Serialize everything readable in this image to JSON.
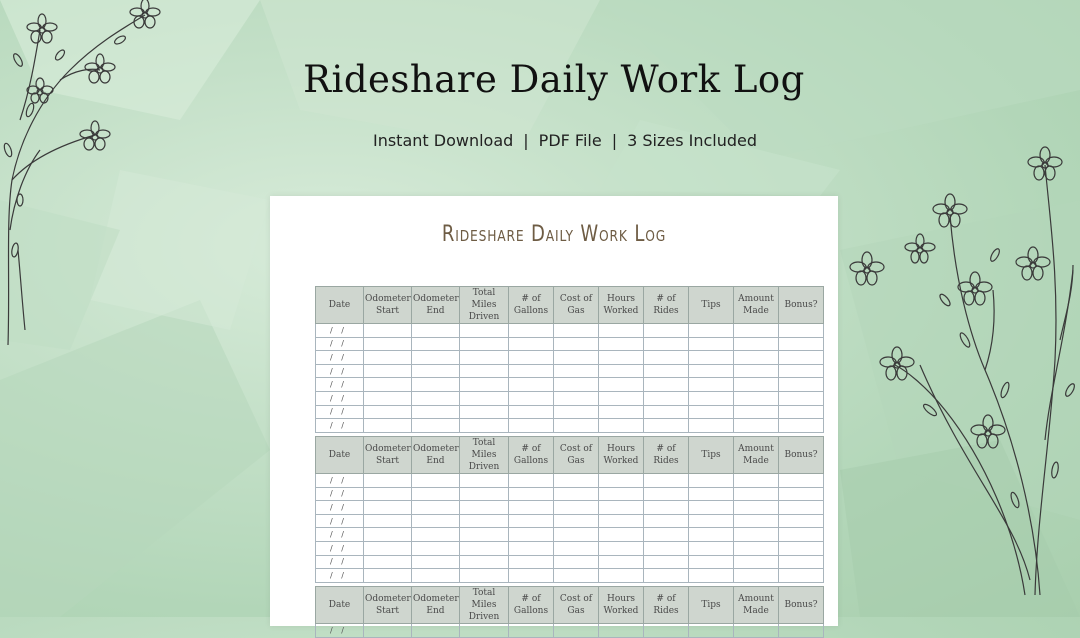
{
  "hero": {
    "title": "Rideshare Daily Work Log",
    "subtitle_parts": [
      "Instant Download",
      "PDF File",
      "3 Sizes Included"
    ],
    "separator": "|"
  },
  "sheet": {
    "title": "Rideshare Daily Work Log",
    "columns": [
      "Date",
      "Odometer Start",
      "Odometer End",
      "Total Miles Driven",
      "# of Gallons",
      "Cost of Gas",
      "Hours Worked",
      "# of Rides",
      "Tips",
      "Amount Made",
      "Bonus?"
    ],
    "date_placeholder": "/ /",
    "rows_per_block": 8,
    "blocks_visible": 3
  },
  "colors": {
    "background": "#c4e0c8",
    "header_fill": "#cfd6cf",
    "sheet_title": "#6e5c44",
    "line_art": "#3a3a3a"
  },
  "decor": {
    "left": "wildflower-sprig-icon",
    "right": "wildflower-bouquet-icon"
  }
}
